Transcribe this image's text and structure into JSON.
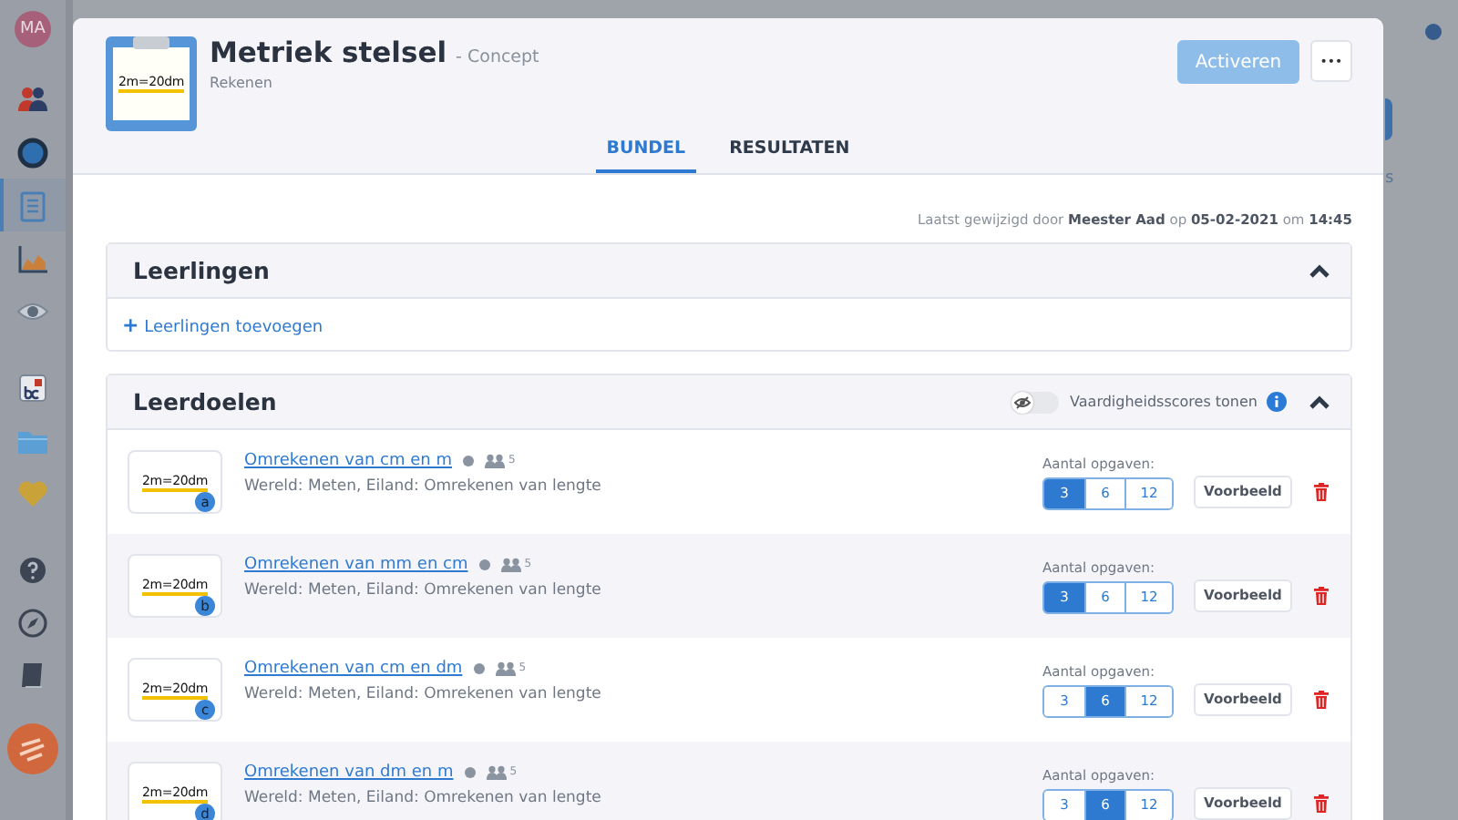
{
  "sidebar": {
    "avatar": "MA",
    "items": [
      {
        "selected": false
      },
      {
        "selected": false
      },
      {
        "selected": true
      },
      {
        "selected": false
      },
      {
        "selected": false
      },
      {
        "selected": false
      },
      {
        "selected": false
      },
      {
        "selected": false
      },
      {
        "selected": false
      },
      {
        "selected": false
      },
      {
        "selected": false
      }
    ]
  },
  "background": {
    "fragment": "s"
  },
  "modal": {
    "title": "Metriek stelsel",
    "status": "- Concept",
    "subject": "Rekenen",
    "thumbnail_text": "2m=20dm",
    "activate_button": "Activeren",
    "more_button": "•••",
    "tabs": [
      {
        "label": "BUNDEL",
        "selected": true
      },
      {
        "label": "RESULTATEN",
        "selected": false
      }
    ],
    "last_modified": "Laatst gewijzigd door **Meester Aad** op **05-02-2021** om **14:45**",
    "students": {
      "title": "Leerlingen",
      "expanded": true,
      "add_icon": "+",
      "add_link": "Leerlingen toevoegen"
    },
    "goals": {
      "title": "Leerdoelen",
      "expanded": true,
      "toggle": {
        "label": "Vaardigheidsscores tonen",
        "on": false
      },
      "items": [
        {
          "thumbnail_text": "2m=20dm",
          "badge": "a",
          "title": "Omrekenen van cm en m",
          "count": "5",
          "subtitle": "Wereld: Meten, Eiland: Omrekenen van lengte",
          "count_label": "Aantal opgaven:",
          "options": [
            {
              "label": "3",
              "selected": true
            },
            {
              "label": "6",
              "selected": false
            },
            {
              "label": "12",
              "selected": false
            }
          ],
          "preview_button": "Voorbeeld"
        },
        {
          "thumbnail_text": "2m=20dm",
          "badge": "b",
          "title": "Omrekenen van mm en cm",
          "count": "5",
          "subtitle": "Wereld: Meten, Eiland: Omrekenen van lengte",
          "count_label": "Aantal opgaven:",
          "options": [
            {
              "label": "3",
              "selected": true
            },
            {
              "label": "6",
              "selected": false
            },
            {
              "label": "12",
              "selected": false
            }
          ],
          "preview_button": "Voorbeeld"
        },
        {
          "thumbnail_text": "2m=20dm",
          "badge": "c",
          "title": "Omrekenen van cm en dm",
          "count": "5",
          "subtitle": "Wereld: Meten, Eiland: Omrekenen van lengte",
          "count_label": "Aantal opgaven:",
          "options": [
            {
              "label": "3",
              "selected": false
            },
            {
              "label": "6",
              "selected": true
            },
            {
              "label": "12",
              "selected": false
            }
          ],
          "preview_button": "Voorbeeld"
        },
        {
          "thumbnail_text": "2m=20dm",
          "badge": "d",
          "title": "Omrekenen van dm en m",
          "count": "5",
          "subtitle": "Wereld: Meten, Eiland: Omrekenen van lengte",
          "count_label": "Aantal opgaven:",
          "options": [
            {
              "label": "3",
              "selected": false
            },
            {
              "label": "6",
              "selected": true
            },
            {
              "label": "12",
              "selected": false
            }
          ],
          "preview_button": "Voorbeeld"
        }
      ]
    }
  }
}
